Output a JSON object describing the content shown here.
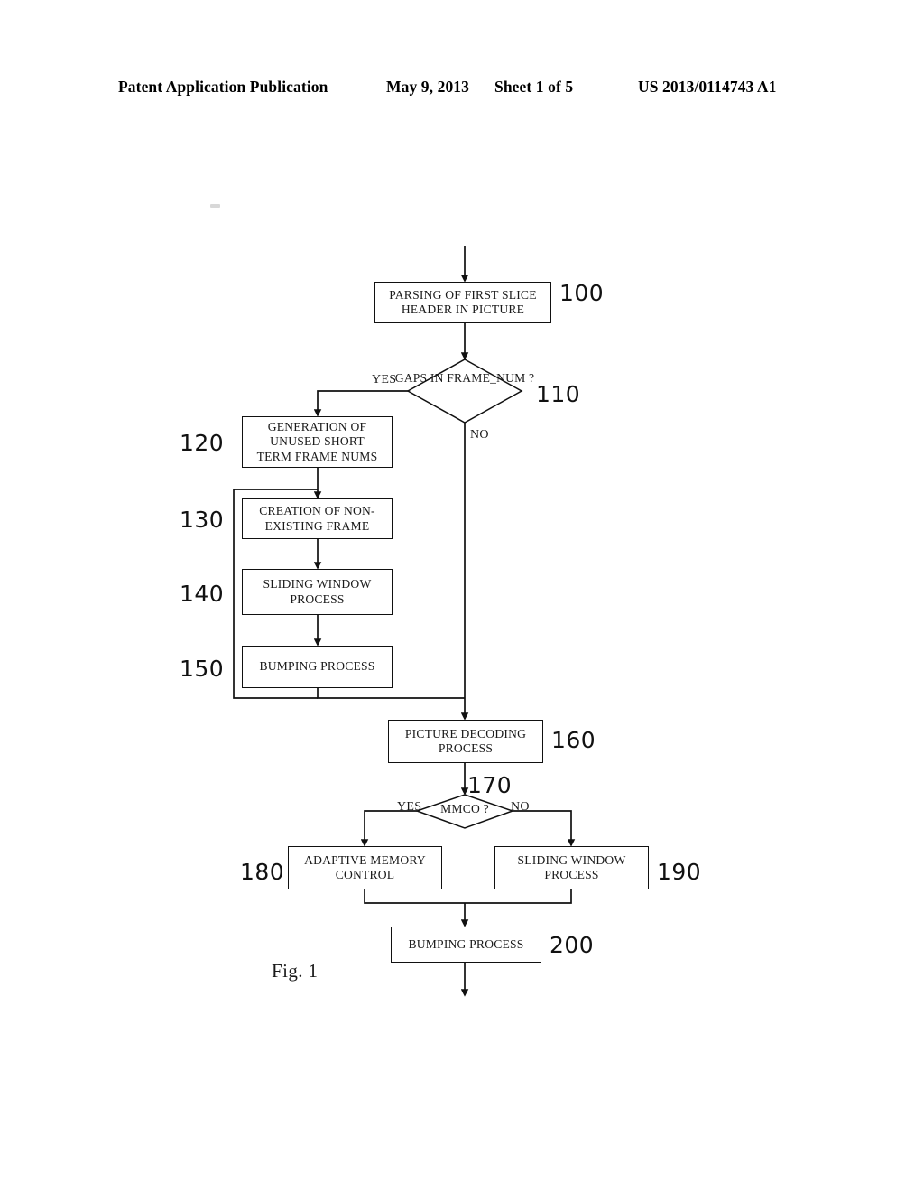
{
  "header": {
    "publication": "Patent Application Publication",
    "date": "May 9, 2013",
    "sheet": "Sheet 1 of 5",
    "patent_number": "US 2013/0114743 A1"
  },
  "figure": {
    "caption": "Fig. 1",
    "nodes": [
      {
        "ref": "100",
        "lines": [
          "PARSING OF FIRST SLICE",
          "HEADER IN PICTURE"
        ],
        "shape": "process"
      },
      {
        "ref": "110",
        "lines": [
          "GAPS IN",
          "FRAME_NUM",
          "?"
        ],
        "shape": "decision"
      },
      {
        "ref": "120",
        "lines": [
          "GENERATION OF",
          "UNUSED SHORT",
          "TERM FRAME NUMS"
        ],
        "shape": "process"
      },
      {
        "ref": "130",
        "lines": [
          "CREATION OF NON-",
          "EXISTING FRAME"
        ],
        "shape": "process"
      },
      {
        "ref": "140",
        "lines": [
          "SLIDING WINDOW",
          "PROCESS"
        ],
        "shape": "process"
      },
      {
        "ref": "150",
        "lines": [
          "BUMPING PROCESS"
        ],
        "shape": "process"
      },
      {
        "ref": "160",
        "lines": [
          "PICTURE DECODING",
          "PROCESS"
        ],
        "shape": "process"
      },
      {
        "ref": "170",
        "lines": [
          "MMCO",
          "?"
        ],
        "shape": "decision"
      },
      {
        "ref": "180",
        "lines": [
          "ADAPTIVE MEMORY",
          "CONTROL"
        ],
        "shape": "process"
      },
      {
        "ref": "190",
        "lines": [
          "SLIDING WINDOW",
          "PROCESS"
        ],
        "shape": "process"
      },
      {
        "ref": "200",
        "lines": [
          "BUMPING PROCESS"
        ],
        "shape": "process"
      }
    ],
    "branch_labels": {
      "gaps_yes": "YES",
      "gaps_no": "NO",
      "mmco_yes": "YES",
      "mmco_no": "NO"
    }
  },
  "colors": {
    "ink": "#111111",
    "paper": "#ffffff"
  }
}
